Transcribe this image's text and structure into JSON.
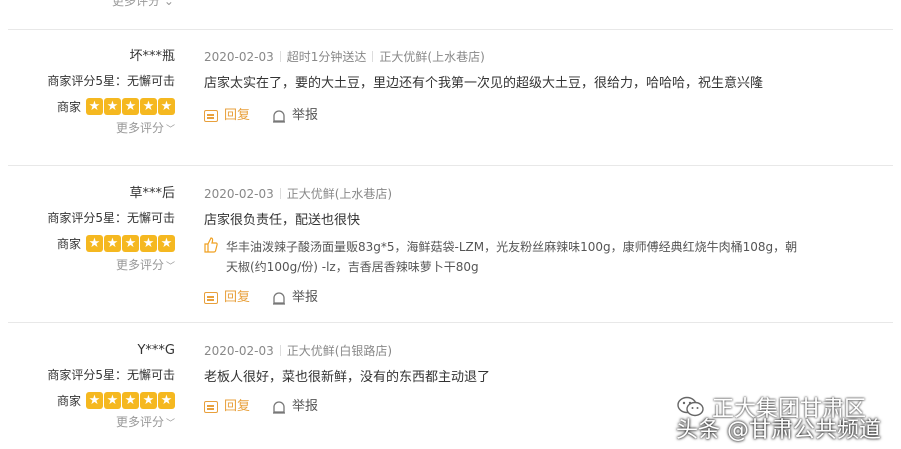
{
  "top_more": "更多评分 ⌄",
  "reviews": [
    {
      "username": "坏***瓶",
      "merchant_rating_text": "商家评分5星：无懈可击",
      "stars_label": "商家",
      "more_rating": "更多评分",
      "date": "2020-02-03",
      "tags": [
        "超时1分钟送达",
        "正大优鲜(上水巷店)"
      ],
      "content": "店家太实在了，要的大土豆，里边还有个我第一次见的超级大土豆，很给力，哈哈哈，祝生意兴隆",
      "products": "",
      "reply_label": "回复",
      "report_label": "举报"
    },
    {
      "username": "草***后",
      "merchant_rating_text": "商家评分5星：无懈可击",
      "stars_label": "商家",
      "more_rating": "更多评分",
      "date": "2020-02-03",
      "tags": [
        "正大优鲜(上水巷店)"
      ],
      "content": "店家很负责任，配送也很快",
      "products": "华丰油泼辣子酸汤面量贩83g*5，海鲜菇袋-LZM，光友粉丝麻辣味100g，康师傅经典红烧牛肉桶108g，朝天椒(约100g/份) -lz，吉香居香辣味萝卜干80g",
      "reply_label": "回复",
      "report_label": "举报"
    },
    {
      "username": "Y***G",
      "merchant_rating_text": "商家评分5星：无懈可击",
      "stars_label": "商家",
      "more_rating": "更多评分",
      "date": "2020-02-03",
      "tags": [
        "正大优鲜(白银路店)"
      ],
      "content": "老板人很好，菜也很新鲜，没有的东西都主动退了",
      "products": "",
      "reply_label": "回复",
      "report_label": "举报"
    }
  ],
  "watermark": {
    "line1": "正大集团甘肃区",
    "line2": "头条 @甘肃公共频道"
  },
  "colors": {
    "star": "#f5b820",
    "reply": "#e8a03c"
  },
  "icons": {
    "star": "star-icon",
    "reply": "reply-icon",
    "report": "report-icon",
    "thumb": "thumbs-up-icon"
  }
}
